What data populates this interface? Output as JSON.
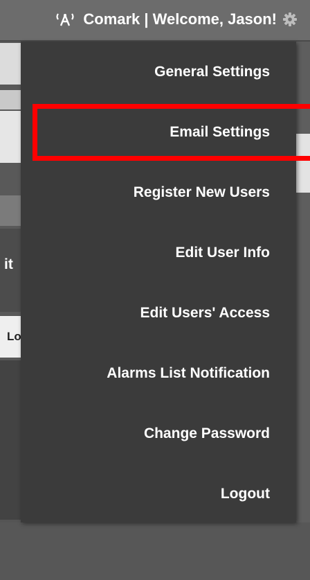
{
  "header": {
    "title": "Comark | Welcome, Jason!",
    "antenna_icon": "antenna-icon",
    "settings_icon": "gear-icon"
  },
  "background_fragments": {
    "fragment_1": "it",
    "fragment_2": "Lo"
  },
  "menu": {
    "items": [
      {
        "label": "General Settings"
      },
      {
        "label": "Email Settings"
      },
      {
        "label": "Register New Users"
      },
      {
        "label": "Edit User Info"
      },
      {
        "label": "Edit Users' Access"
      },
      {
        "label": "Alarms List Notification"
      },
      {
        "label": "Change Password"
      },
      {
        "label": "Logout"
      }
    ]
  },
  "colors": {
    "header_bg": "#6c6c6c",
    "menu_bg": "#3b3b3b",
    "menu_text": "#ffffff",
    "highlight": "#ff0000"
  }
}
